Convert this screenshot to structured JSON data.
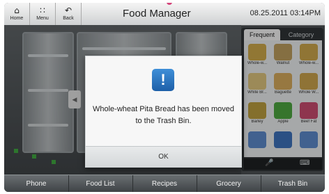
{
  "header": {
    "home_label": "Home",
    "menu_label": "Menu",
    "back_label": "Back",
    "title": "Food Manager",
    "datetime": "08.25.2011 03:14PM"
  },
  "panel": {
    "tabs": [
      {
        "label": "Frequent",
        "active": true
      },
      {
        "label": "Category",
        "active": false
      }
    ],
    "items": [
      {
        "name": "Whole-w...",
        "color": "#c9a648"
      },
      {
        "name": "Walnut",
        "color": "#b99a5c"
      },
      {
        "name": "Whole-w...",
        "color": "#c8a24a"
      },
      {
        "name": "White Br...",
        "color": "#d8c07a"
      },
      {
        "name": "Baguette",
        "color": "#d2a75a"
      },
      {
        "name": "Whole W...",
        "color": "#c6a04c"
      },
      {
        "name": "Barley",
        "color": "#b89a3e"
      },
      {
        "name": "Apple",
        "color": "#4ba23f"
      },
      {
        "name": "Beef Fat",
        "color": "#c54a6c"
      },
      {
        "name": "",
        "color": "#5a87c6"
      },
      {
        "name": "",
        "color": "#3c6fb8"
      },
      {
        "name": "",
        "color": "#5a87c6"
      }
    ]
  },
  "dialog": {
    "message": "Whole-wheat Pita Bread has been moved to the Trash Bin.",
    "ok_label": "OK"
  },
  "bottom_nav": [
    "Phone",
    "Food List",
    "Recipes",
    "Grocery",
    "Trash Bin"
  ]
}
